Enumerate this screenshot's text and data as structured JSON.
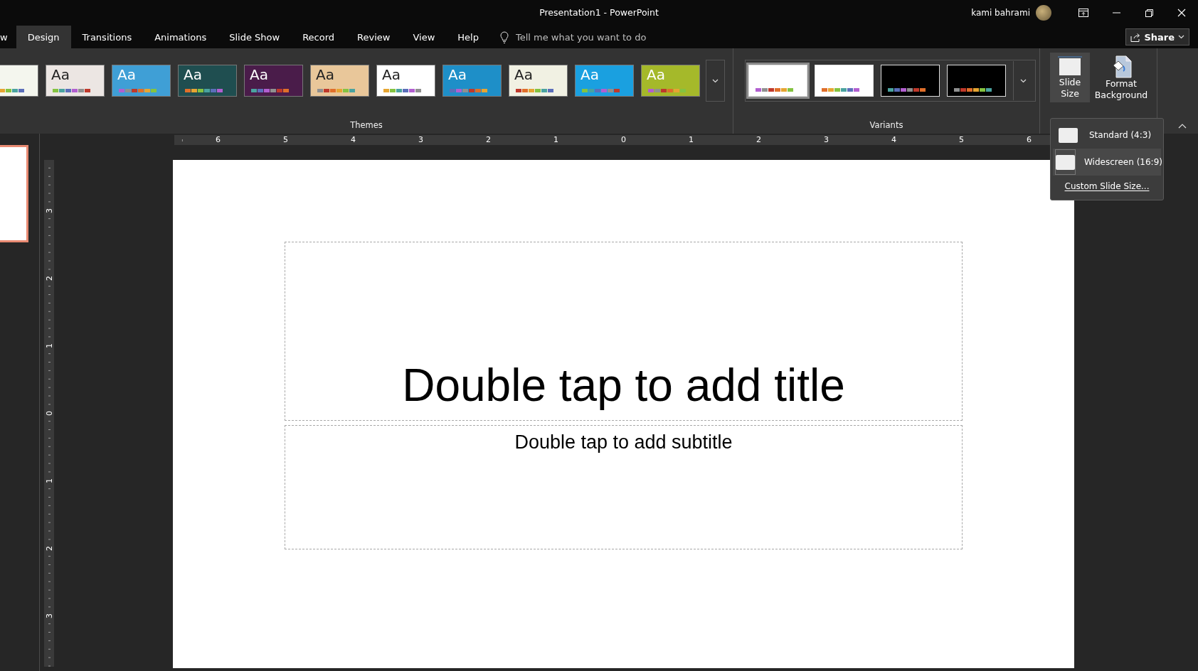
{
  "window": {
    "title": "Presentation1  -  PowerPoint",
    "user": "kami bahrami"
  },
  "share_button": {
    "label": "Share"
  },
  "tabs": [
    {
      "label": "w",
      "selected": false
    },
    {
      "label": "Design",
      "selected": true
    },
    {
      "label": "Transitions",
      "selected": false
    },
    {
      "label": "Animations",
      "selected": false
    },
    {
      "label": "Slide Show",
      "selected": false
    },
    {
      "label": "Record",
      "selected": false
    },
    {
      "label": "Review",
      "selected": false
    },
    {
      "label": "View",
      "selected": false
    },
    {
      "label": "Help",
      "selected": false
    }
  ],
  "tell_me": {
    "placeholder": "Tell me what you want to do"
  },
  "themes": {
    "label": "Themes",
    "items": [
      {
        "color": "#f4f6ee"
      },
      {
        "sample": "Aa",
        "color": "#ece6e3"
      },
      {
        "sample": "Aa",
        "color": "#3f9fd6"
      },
      {
        "sample": "Aa",
        "color": "#1f4e50"
      },
      {
        "sample": "Aa",
        "color": "#4a1c4a"
      },
      {
        "sample": "Aa",
        "color": "#e9c79a"
      },
      {
        "sample": "Aa",
        "color": "#ffffff"
      },
      {
        "sample": "Aa",
        "color": "#1e8fc8"
      },
      {
        "sample": "Aa",
        "color": "#f1f1e3"
      },
      {
        "sample": "Aa",
        "color": "#1aa0e0"
      },
      {
        "sample": "Aa",
        "color": "#a5b92a"
      }
    ]
  },
  "variants": {
    "label": "Variants",
    "items": [
      {
        "color": "#ffffff",
        "selected": true
      },
      {
        "color": "#ffffff",
        "selected": false
      },
      {
        "color": "#000000",
        "selected": false
      },
      {
        "color": "#000000",
        "selected": false
      }
    ]
  },
  "slide_size": {
    "label": "Slide Size",
    "expanded": true
  },
  "format_background": {
    "label": "Format Background"
  },
  "slide_size_menu": {
    "items": [
      {
        "label": "Standard (4:3)",
        "selected": false
      },
      {
        "label": "Widescreen (16:9)",
        "selected": true
      }
    ],
    "custom": "Custom Slide Size..."
  },
  "thumbnails": [
    {
      "selected": true
    }
  ],
  "rulers": {
    "horizontal": [
      "6",
      "5",
      "4",
      "3",
      "2",
      "1",
      "0",
      "1",
      "2",
      "3",
      "4",
      "5",
      "6"
    ],
    "vertical": [
      "3",
      "2",
      "1",
      "0",
      "1",
      "2",
      "3"
    ]
  },
  "slide": {
    "title_placeholder": "Double tap to add title",
    "subtitle_placeholder": "Double tap to add subtitle"
  }
}
